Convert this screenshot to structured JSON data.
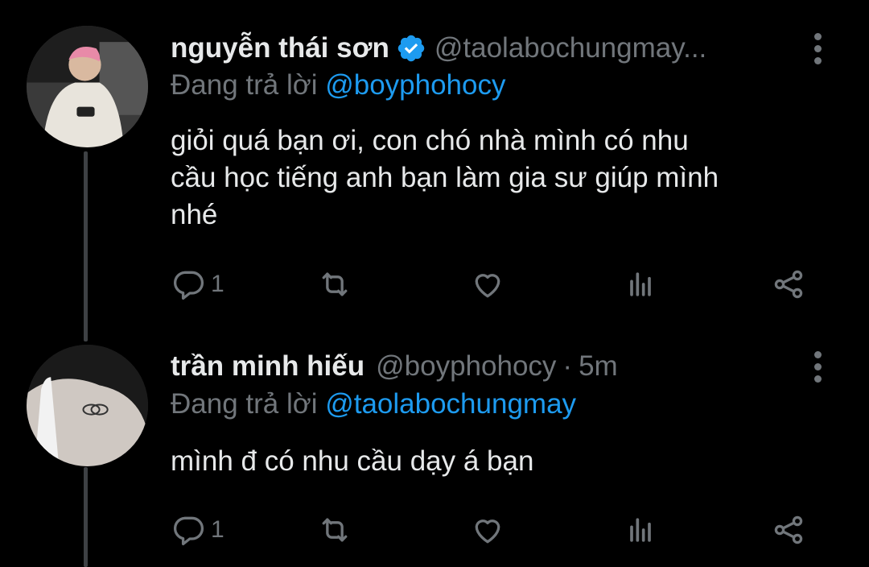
{
  "tweets": [
    {
      "name": "nguyễn thái sơn",
      "verified": true,
      "handle": "@taolabochungmay...",
      "time": "",
      "replying_prefix": "Đang trả lời ",
      "replying_to": "@boyphohocy",
      "text": "giỏi quá bạn ơi, con chó nhà mình có nhu\ncầu học tiếng anh bạn làm gia sư giúp mình\nnhé",
      "reply_count": "1"
    },
    {
      "name": "trần minh hiếu",
      "verified": false,
      "handle": "@boyphohocy",
      "time": "5m",
      "replying_prefix": "Đang trả lời ",
      "replying_to": "@taolabochungmay",
      "text": "mình đ có nhu cầu dạy á bạn",
      "reply_count": "1"
    }
  ],
  "colors": {
    "background": "#000000",
    "text": "#e7e9ea",
    "secondary": "#71767b",
    "accent": "#1d9bf0",
    "thread_line": "#3e4144"
  },
  "icons": [
    "more-vertical-icon",
    "verified-badge-icon",
    "reply-icon",
    "retweet-icon",
    "like-icon",
    "views-icon",
    "share-icon"
  ]
}
